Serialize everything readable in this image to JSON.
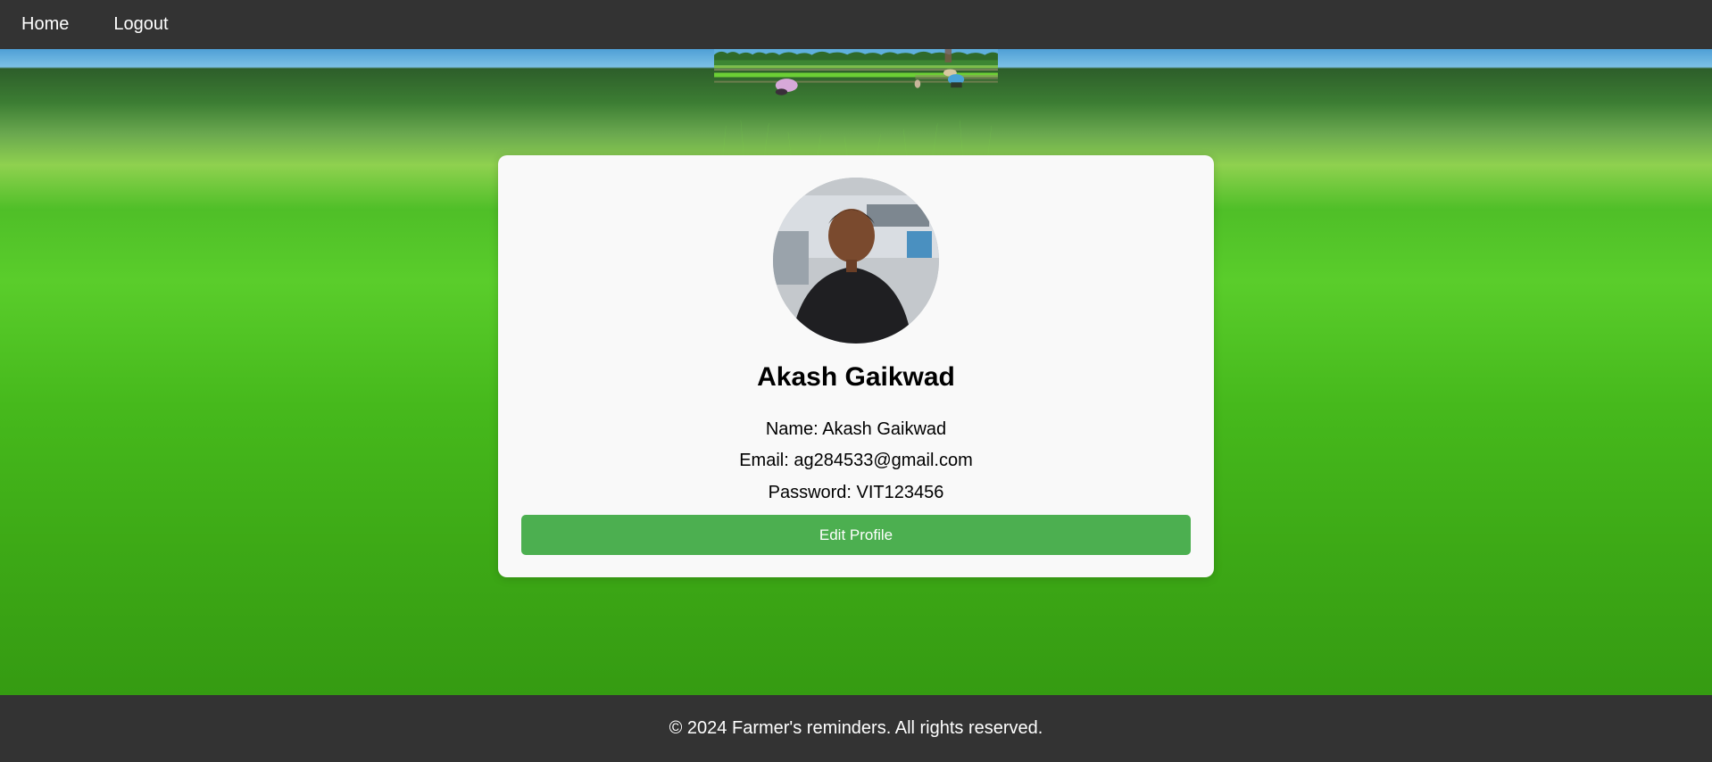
{
  "nav": {
    "home": "Home",
    "logout": "Logout"
  },
  "profile": {
    "display_name": "Akash Gaikwad",
    "name_line": "Name: Akash Gaikwad",
    "email_line": "Email: ag284533@gmail.com",
    "password_line": "Password: VIT123456",
    "edit_button": "Edit Profile"
  },
  "footer": {
    "text": "© 2024 Farmer's reminders. All rights reserved."
  },
  "colors": {
    "navbar": "#333333",
    "card": "#f9f9f9",
    "button": "#4caf50",
    "field_green": "#4fbf28"
  }
}
